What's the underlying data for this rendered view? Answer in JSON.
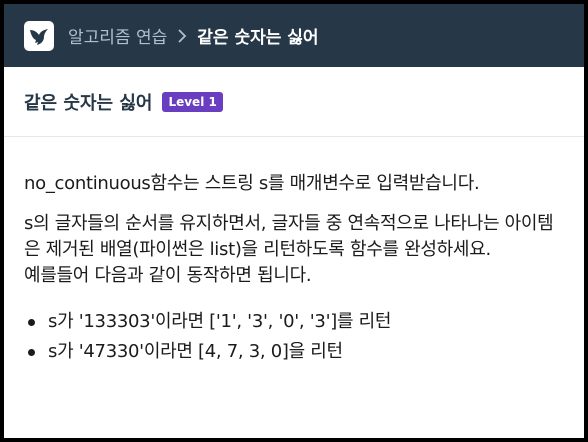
{
  "breadcrumb": {
    "parent": "알고리즘 연습",
    "current": "같은 숫자는 싫어"
  },
  "problem": {
    "title": "같은 숫자는 싫어",
    "level": "Level 1",
    "paragraphs": [
      "no_continuous함수는 스트링 s를 매개변수로 입력받습니다.",
      "s의 글자들의 순서를 유지하면서, 글자들 중 연속적으로 나타나는 아이템은 제거된 배열(파이썬은 list)을 리턴하도록 함수를 완성하세요.",
      "예를들어 다음과 같이 동작하면 됩니다."
    ],
    "examples": [
      "s가 '133303'이라면 ['1', '3', '0', '3']를 리턴",
      "s가 '47330'이라면 [4, 7, 3, 0]을 리턴"
    ]
  },
  "colors": {
    "topbar": "#263747",
    "badge": "#6a3ec1"
  },
  "icons": {
    "logo": "bird-logo-icon",
    "separator": "chevron-right-icon"
  }
}
